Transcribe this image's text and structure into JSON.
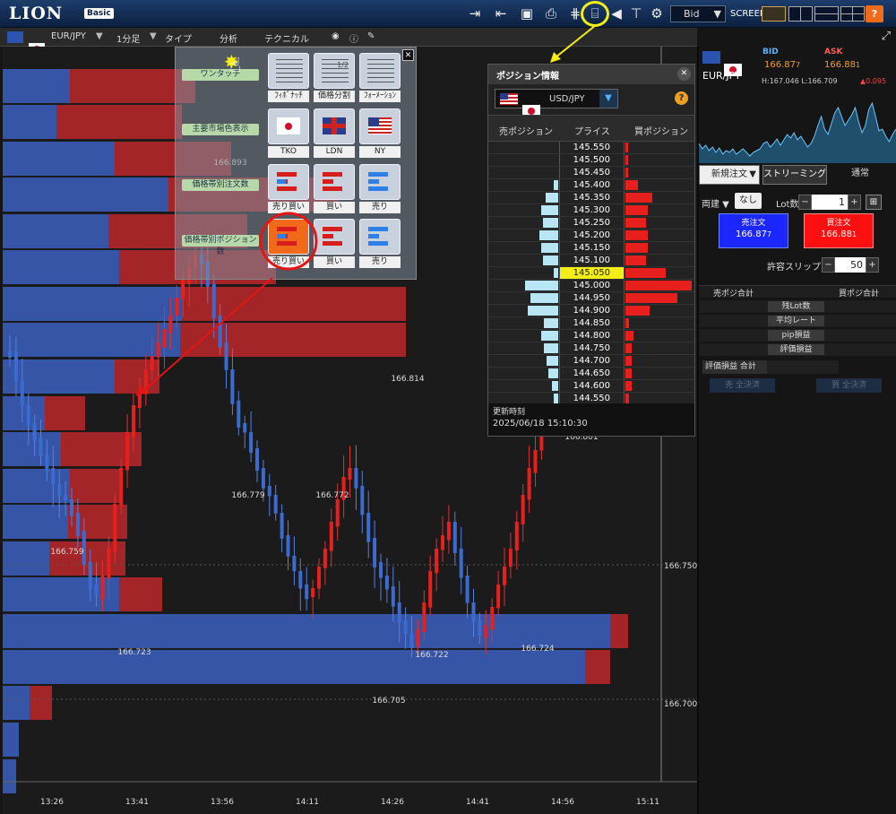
{
  "app": {
    "logo": "LION",
    "badge": "Basic",
    "price_type": "Bid",
    "screen_label": "SCREEN",
    "help": "?"
  },
  "chart_toolbar": {
    "pair": "EUR/JPY",
    "timeframe": "1分足",
    "type": "タイプ",
    "analysis": "分析",
    "technical": "テクニカル"
  },
  "chart": {
    "y_labels": [
      "166.750",
      "166.700"
    ],
    "x_labels": [
      "13:26",
      "13:41",
      "13:56",
      "14:11",
      "14:26",
      "14:41",
      "14:56",
      "15:11"
    ],
    "annotations": [
      "166.893",
      "166.814",
      "166.779",
      "166.772",
      "166.759",
      "166.723",
      "166.722",
      "166.724",
      "166.705",
      "166.801"
    ]
  },
  "menu": {
    "labels": [
      "ワンタッチ",
      "主要市場色表示",
      "価格帯別注文数",
      "価格帯別ポジション数"
    ],
    "row1": [
      "ﾌｨﾎﾞﾅｯﾁ",
      "価格分割",
      "ﾌｫｰﾒｰｼｮﾝ"
    ],
    "row2": [
      "TKO",
      "LDN",
      "NY"
    ],
    "row3": [
      "売り買い",
      "買い",
      "売り"
    ],
    "row4": [
      "売り買い",
      "買い",
      "売り"
    ],
    "half_mark": "1/2"
  },
  "position_panel": {
    "title": "ポジション情報",
    "pair": "USD/JPY",
    "col_sell": "売ポジション",
    "col_price": "プライス",
    "col_buy": "買ポジション",
    "rows": [
      {
        "price": "145.550",
        "sell": 0.0,
        "buy": 0.04
      },
      {
        "price": "145.500",
        "sell": 0.0,
        "buy": 0.04
      },
      {
        "price": "145.450",
        "sell": 0.0,
        "buy": 0.04
      },
      {
        "price": "145.400",
        "sell": 0.08,
        "buy": 0.19
      },
      {
        "price": "145.350",
        "sell": 0.22,
        "buy": 0.4
      },
      {
        "price": "145.300",
        "sell": 0.3,
        "buy": 0.34
      },
      {
        "price": "145.250",
        "sell": 0.28,
        "buy": 0.31
      },
      {
        "price": "145.200",
        "sell": 0.34,
        "buy": 0.34
      },
      {
        "price": "145.150",
        "sell": 0.3,
        "buy": 0.34
      },
      {
        "price": "145.100",
        "sell": 0.28,
        "buy": 0.31
      },
      {
        "price": "145.050",
        "sell": 0.08,
        "buy": 0.61
      },
      {
        "price": "145.000",
        "sell": 0.6,
        "buy": 1.0
      },
      {
        "price": "144.950",
        "sell": 0.5,
        "buy": 0.79
      },
      {
        "price": "144.900",
        "sell": 0.55,
        "buy": 0.36
      },
      {
        "price": "144.850",
        "sell": 0.26,
        "buy": 0.06
      },
      {
        "price": "144.800",
        "sell": 0.3,
        "buy": 0.12
      },
      {
        "price": "144.750",
        "sell": 0.26,
        "buy": 0.09
      },
      {
        "price": "144.700",
        "sell": 0.21,
        "buy": 0.09
      },
      {
        "price": "144.650",
        "sell": 0.18,
        "buy": 0.1
      },
      {
        "price": "144.600",
        "sell": 0.11,
        "buy": 0.09
      },
      {
        "price": "144.550",
        "sell": 0.08,
        "buy": 0.05
      }
    ],
    "updated_label": "更新時刻",
    "updated_time": "2025/06/18 15:10:30",
    "help": "?"
  },
  "rate_panel": {
    "pair": "EUR/JPY",
    "bid_label": "BID",
    "ask_label": "ASK",
    "bid": "166.87",
    "bid_small": "7",
    "ask": "166.88",
    "ask_small": "1",
    "hl": "H:167.046  L:166.709",
    "change": "▲0.095"
  },
  "order_panel": {
    "mode": "新規注文",
    "tab_streaming": "ストリーミング",
    "tab_normal": "通常",
    "both": "両建 ▼",
    "none": "なし",
    "lot_label": "Lot数",
    "lot": "1",
    "sell_title": "売注文",
    "sell_price": "166.87",
    "sell_small": "7",
    "buy_title": "買注文",
    "buy_price": "166.88",
    "buy_small": "1",
    "slip_label": "許容スリップ",
    "slip": "50",
    "sell_total": "売ポジ合計",
    "buy_total": "買ポジ合計",
    "rows": [
      "残Lot数",
      "平均レート",
      "pip損益",
      "評価損益"
    ],
    "eval_total": "評価損益 合計",
    "sell_all": "売 全決済",
    "buy_all": "買 全決済"
  },
  "colors": {
    "buy": "#e8201d",
    "sell": "#3b6bd0",
    "highlight": "#f3ee15",
    "annot": "#e31515"
  }
}
